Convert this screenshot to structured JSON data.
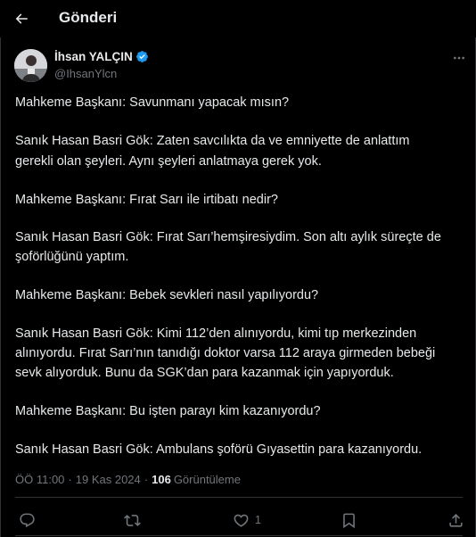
{
  "header": {
    "title": "Gönderi"
  },
  "author": {
    "name": "İhsan YALÇIN",
    "handle": "@IhsanYlcn"
  },
  "tweet": {
    "lines": [
      "Mahkeme Başkanı: Savunmanı yapacak mısın?",
      "Sanık Hasan Basri Gök: Zaten savcılıkta da ve emniyette de anlattım",
      "gerekli olan şeyleri. Aynı şeyleri anlatmaya gerek yok.",
      "Mahkeme Başkanı: Fırat Sarı ile irtibatı nedir?",
      "Sanık Hasan Basri Gök: Fırat Sarı’hemşiresiydim. Son altı aylık süreçte de",
      "şoförlüğünü yaptım.",
      "Mahkeme Başkanı: Bebek sevkleri nasıl yapılıyordu?",
      "Sanık Hasan Basri Gök: Kimi 112’den alınıyordu, kimi tıp merkezinden",
      "alınıyordu. Fırat Sarı’nın tanıdığı doktor varsa 112 araya girmeden bebeği",
      "sevk alıyorduk. Bunu da SGK’dan para kazanmak için yapıyorduk.",
      "Mahkeme Başkanı: Bu işten parayı kim kazanıyordu?",
      "Sanık Hasan Basri Gök: Ambulans şoförü Gıyasettin para kazanıyordu."
    ]
  },
  "meta": {
    "time": "ÖÖ 11:00",
    "separator": "·",
    "date": "19 Kas 2024",
    "views_count": "106",
    "views_label": "Görüntüleme"
  },
  "actions": {
    "like_count": "1"
  },
  "colors": {
    "background": "#000000",
    "text": "#e7e9ea",
    "secondary": "#71767b",
    "border": "#2f3336",
    "verified": "#1d9bf0"
  },
  "icons": [
    "back-arrow-icon",
    "verified-badge-icon",
    "more-icon",
    "reply-icon",
    "retweet-icon",
    "like-icon",
    "bookmark-icon",
    "share-icon"
  ]
}
